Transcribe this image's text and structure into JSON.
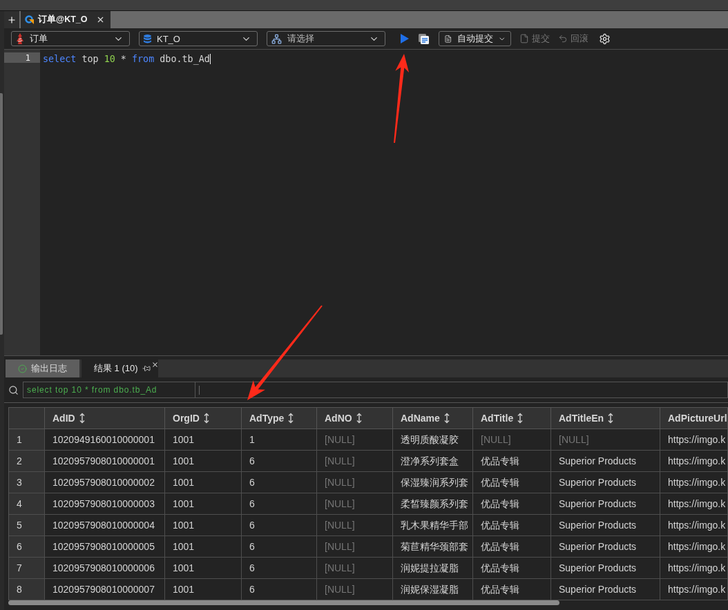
{
  "editor_tabs": [
    {
      "label": "订单@KT_O",
      "selected": true
    }
  ],
  "toolbar": {
    "connection": {
      "value": "订单"
    },
    "database": {
      "value": "KT_O"
    },
    "schema": {
      "placeholder": "请选择"
    },
    "autocommit": {
      "label": "自动提交"
    },
    "actions": [
      {
        "kind": "commit",
        "label": "提交",
        "disabled": true
      },
      {
        "kind": "rollback",
        "label": "回滚",
        "disabled": true
      }
    ]
  },
  "editor": {
    "lines": [
      {
        "number": "1",
        "current": true,
        "tokens": [
          {
            "kind": "keyword",
            "text": "select"
          },
          {
            "kind": "plain",
            "text": " top "
          },
          {
            "kind": "number",
            "text": "10"
          },
          {
            "kind": "plain",
            "text": " * "
          },
          {
            "kind": "keyword",
            "text": "from"
          },
          {
            "kind": "plain",
            "text": " dbo.tb_Ad"
          }
        ]
      }
    ]
  },
  "result_tabs": [
    {
      "kind": "log",
      "label": "输出日志",
      "selected": false
    },
    {
      "kind": "result",
      "label": "结果 1 (10)",
      "selected": true
    }
  ],
  "filter_bar": {
    "query": "select top 10 * from dbo.tb_Ad"
  },
  "table": {
    "columns": [
      {
        "label": "AdID",
        "sortable": true
      },
      {
        "label": "OrgID",
        "sortable": true
      },
      {
        "label": "AdType",
        "sortable": true
      },
      {
        "label": "AdNO",
        "sortable": true
      },
      {
        "label": "AdName",
        "sortable": true
      },
      {
        "label": "AdTitle",
        "sortable": true
      },
      {
        "label": "AdTitleEn",
        "sortable": true
      },
      {
        "label": "AdPictureUrl",
        "sortable": false
      }
    ],
    "rows": [
      {
        "number": "1",
        "cells": [
          {
            "text": "1020949160010000001",
            "null": false
          },
          {
            "text": "1001",
            "null": false
          },
          {
            "text": "1",
            "null": false
          },
          {
            "text": "[NULL]",
            "null": true
          },
          {
            "text": "透明质酸凝胶",
            "null": false
          },
          {
            "text": "[NULL]",
            "null": true
          },
          {
            "text": "[NULL]",
            "null": true
          },
          {
            "text": "https://imgo.k",
            "null": false
          }
        ]
      },
      {
        "number": "2",
        "cells": [
          {
            "text": "1020957908010000001",
            "null": false
          },
          {
            "text": "1001",
            "null": false
          },
          {
            "text": "6",
            "null": false
          },
          {
            "text": "[NULL]",
            "null": true
          },
          {
            "text": "澄净系列套盒",
            "null": false
          },
          {
            "text": "优品专辑",
            "null": false
          },
          {
            "text": "Superior Products",
            "null": false
          },
          {
            "text": "https://imgo.k",
            "null": false
          }
        ]
      },
      {
        "number": "3",
        "cells": [
          {
            "text": "1020957908010000002",
            "null": false
          },
          {
            "text": "1001",
            "null": false
          },
          {
            "text": "6",
            "null": false
          },
          {
            "text": "[NULL]",
            "null": true
          },
          {
            "text": "保湿臻润系列套",
            "null": false
          },
          {
            "text": "优品专辑",
            "null": false
          },
          {
            "text": "Superior Products",
            "null": false
          },
          {
            "text": "https://imgo.k",
            "null": false
          }
        ]
      },
      {
        "number": "4",
        "cells": [
          {
            "text": "1020957908010000003",
            "null": false
          },
          {
            "text": "1001",
            "null": false
          },
          {
            "text": "6",
            "null": false
          },
          {
            "text": "[NULL]",
            "null": true
          },
          {
            "text": "柔皙臻颜系列套",
            "null": false
          },
          {
            "text": "优品专辑",
            "null": false
          },
          {
            "text": "Superior Products",
            "null": false
          },
          {
            "text": "https://imgo.k",
            "null": false
          }
        ]
      },
      {
        "number": "5",
        "cells": [
          {
            "text": "1020957908010000004",
            "null": false
          },
          {
            "text": "1001",
            "null": false
          },
          {
            "text": "6",
            "null": false
          },
          {
            "text": "[NULL]",
            "null": true
          },
          {
            "text": "乳木果精华手部",
            "null": false
          },
          {
            "text": "优品专辑",
            "null": false
          },
          {
            "text": "Superior Products",
            "null": false
          },
          {
            "text": "https://imgo.k",
            "null": false
          }
        ]
      },
      {
        "number": "6",
        "cells": [
          {
            "text": "1020957908010000005",
            "null": false
          },
          {
            "text": "1001",
            "null": false
          },
          {
            "text": "6",
            "null": false
          },
          {
            "text": "[NULL]",
            "null": true
          },
          {
            "text": "菊苣精华颈部套",
            "null": false
          },
          {
            "text": "优品专辑",
            "null": false
          },
          {
            "text": "Superior Products",
            "null": false
          },
          {
            "text": "https://imgo.k",
            "null": false
          }
        ]
      },
      {
        "number": "7",
        "cells": [
          {
            "text": "1020957908010000006",
            "null": false
          },
          {
            "text": "1001",
            "null": false
          },
          {
            "text": "6",
            "null": false
          },
          {
            "text": "[NULL]",
            "null": true
          },
          {
            "text": "润妮提拉凝脂",
            "null": false
          },
          {
            "text": "优品专辑",
            "null": false
          },
          {
            "text": "Superior Products",
            "null": false
          },
          {
            "text": "https://imgo.k",
            "null": false
          }
        ]
      },
      {
        "number": "8",
        "cells": [
          {
            "text": "1020957908010000007",
            "null": false
          },
          {
            "text": "1001",
            "null": false
          },
          {
            "text": "6",
            "null": false
          },
          {
            "text": "[NULL]",
            "null": true
          },
          {
            "text": "润妮保湿凝脂",
            "null": false
          },
          {
            "text": "优品专辑",
            "null": false
          },
          {
            "text": "Superior Products",
            "null": false
          },
          {
            "text": "https://imgo.k",
            "null": false
          }
        ]
      }
    ]
  }
}
